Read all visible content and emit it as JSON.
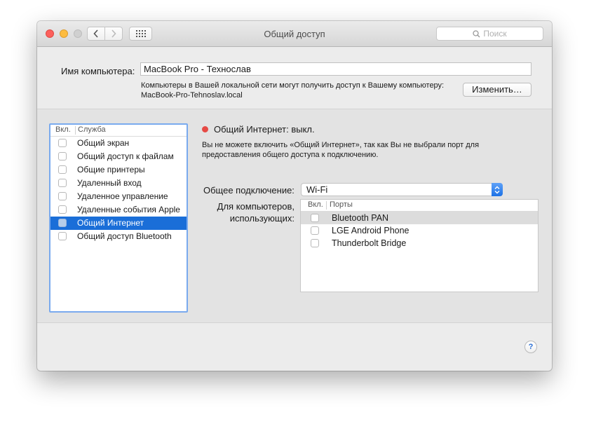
{
  "window": {
    "title": "Общий доступ",
    "search_placeholder": "Поиск"
  },
  "computer": {
    "name_label": "Имя компьютера:",
    "name_value": "MacBook Pro - Технослав",
    "hint_line1": "Компьютеры в Вашей локальной сети могут получить доступ к Вашему компьютеру:",
    "hint_line2": "MacBook-Pro-Tehnoslav.local",
    "edit_button": "Изменить…"
  },
  "services": {
    "header_on": "Вкл.",
    "header_name": "Служба",
    "items": [
      {
        "label": "Общий экран",
        "checked": false,
        "selected": false
      },
      {
        "label": "Общий доступ к файлам",
        "checked": false,
        "selected": false
      },
      {
        "label": "Общие принтеры",
        "checked": false,
        "selected": false
      },
      {
        "label": "Удаленный вход",
        "checked": false,
        "selected": false
      },
      {
        "label": "Удаленное управление",
        "checked": false,
        "selected": false
      },
      {
        "label": "Удаленные события Apple",
        "checked": false,
        "selected": false
      },
      {
        "label": "Общий Интернет",
        "checked": false,
        "selected": true
      },
      {
        "label": "Общий доступ Bluetooth",
        "checked": false,
        "selected": false
      }
    ]
  },
  "detail": {
    "status_title": "Общий Интернет: выкл.",
    "status_color": "#e64a45",
    "status_desc_line1": "Вы не можете включить «Общий Интернет», так как Вы не выбрали порт для",
    "status_desc_line2": "предоставления общего доступа к подключению.",
    "share_label": "Общее подключение:",
    "share_value": "Wi-Fi",
    "for_label_line1": "Для компьютеров,",
    "for_label_line2": "использующих:",
    "ports_header_on": "Вкл.",
    "ports_header_name": "Порты",
    "ports": [
      {
        "label": "Bluetooth PAN",
        "checked": false,
        "highlighted": true
      },
      {
        "label": "LGE Android Phone",
        "checked": false,
        "highlighted": false
      },
      {
        "label": "Thunderbolt Bridge",
        "checked": false,
        "highlighted": false
      }
    ]
  },
  "help_label": "?",
  "accent_color": "#1a6ed8"
}
